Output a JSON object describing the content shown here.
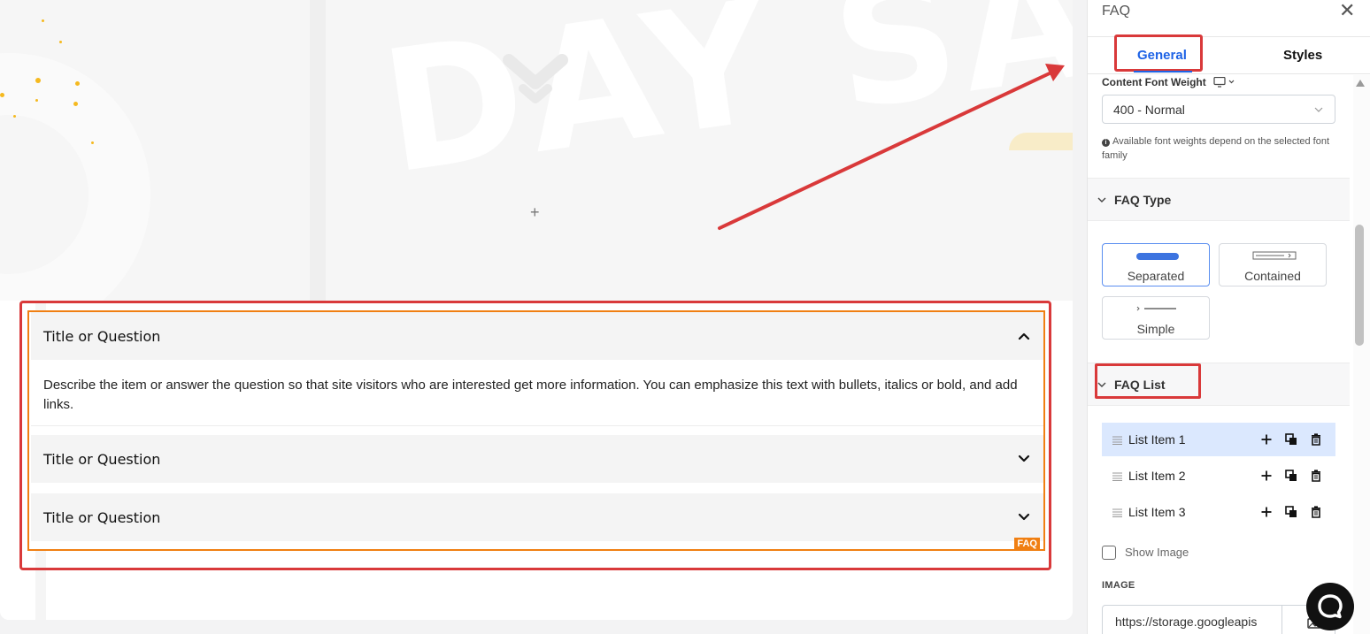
{
  "canvas": {
    "faq": {
      "items": [
        {
          "title": "Title or Question",
          "expanded": true,
          "answer": "Describe the item or answer the question so that site visitors who are interested get more information. You can emphasize this text with bullets, italics or bold, and add links."
        },
        {
          "title": "Title or Question",
          "expanded": false
        },
        {
          "title": "Title or Question",
          "expanded": false
        }
      ],
      "badge": "FAQ"
    },
    "add_icon": "+"
  },
  "panel": {
    "title": "FAQ",
    "close_icon": "✕",
    "tabs": {
      "general": "General",
      "styles": "Styles",
      "active": "General"
    },
    "content_font_weight": {
      "label": "Content Font Weight",
      "value": "400 - Normal",
      "note": "Available font weights depend on the selected font family"
    },
    "faq_type": {
      "heading": "FAQ Type",
      "options": [
        "Separated",
        "Contained",
        "Simple"
      ],
      "selected": "Separated"
    },
    "faq_list": {
      "heading": "FAQ List",
      "items": [
        "List Item 1",
        "List Item 2",
        "List Item 3"
      ],
      "active": "List Item 1"
    },
    "show_image": {
      "label": "Show Image",
      "checked": false
    },
    "image": {
      "label": "IMAGE",
      "url": "https://storage.googleapis"
    }
  },
  "colors": {
    "accent": "#1e63e6",
    "annotation": "#d9393a",
    "faq_outline": "#f07f12"
  }
}
